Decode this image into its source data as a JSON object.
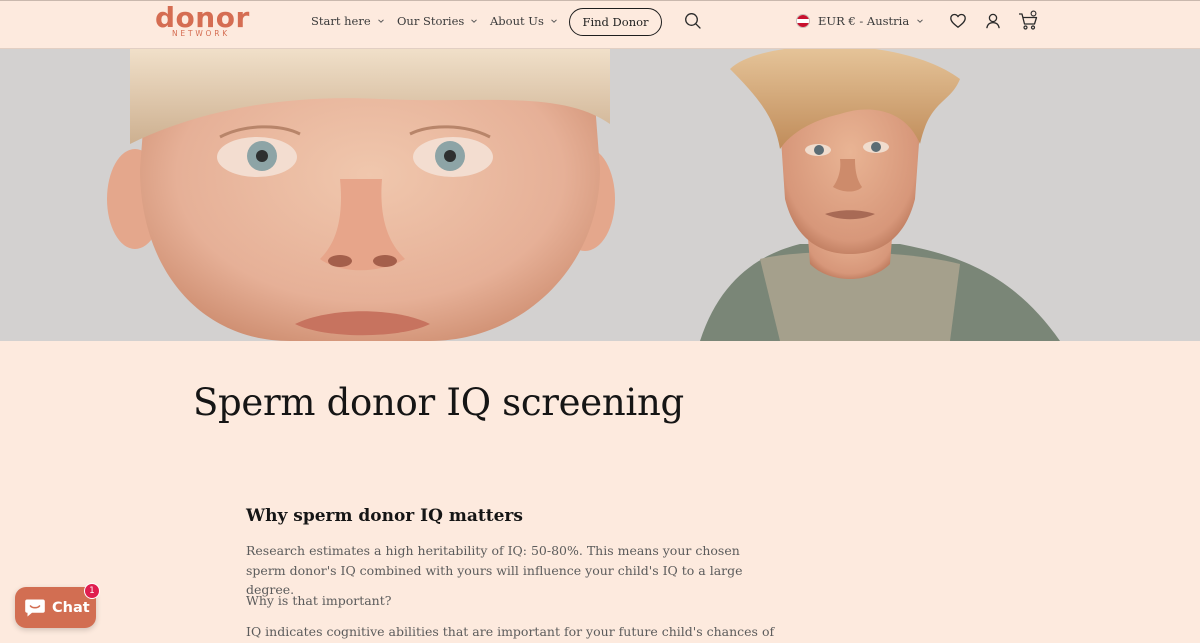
{
  "header": {
    "logo_word": "donor",
    "logo_sub": "NETWORK",
    "nav": [
      {
        "label": "Start here"
      },
      {
        "label": "Our Stories"
      },
      {
        "label": "About Us"
      }
    ],
    "cta_label": "Find Donor",
    "currency_label": "EUR € - Austria"
  },
  "hero": {
    "subjects": [
      "child-portrait",
      "teen-portrait"
    ],
    "background_color": "#d3d1d0"
  },
  "article": {
    "title": "Sperm donor IQ screening",
    "section_heading": "Why sperm donor IQ matters",
    "paragraphs": [
      "Research estimates a high heritability of IQ: 50-80%. This means your chosen sperm donor's IQ combined with yours will influence your child's IQ to a large degree.",
      "Why is that important?",
      "IQ indicates cognitive abilities that are important for your future child's chances of"
    ]
  },
  "chat": {
    "label": "Chat",
    "badge_count": "1"
  },
  "colors": {
    "brand": "#d56d52",
    "page_background": "#fdeade",
    "badge": "#e01e4f"
  },
  "icons": [
    "search-icon",
    "heart-icon",
    "account-icon",
    "cart-icon",
    "chevron-down-icon",
    "chat-bubble-icon",
    "austria-flag-icon"
  ]
}
